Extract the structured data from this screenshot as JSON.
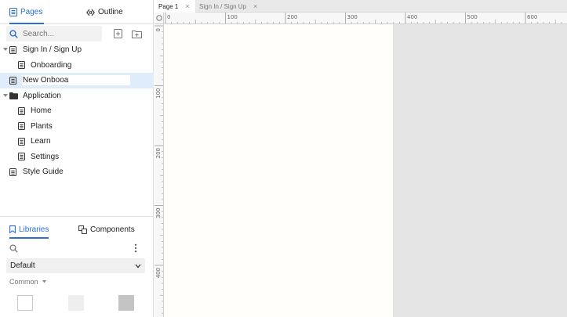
{
  "left_panel": {
    "tabs": [
      {
        "label": "Pages",
        "icon": "page-icon",
        "active": true
      },
      {
        "label": "Outline",
        "icon": "outline-icon",
        "active": false
      }
    ],
    "search": {
      "placeholder": "Search...",
      "value": ""
    },
    "tree": [
      {
        "label": "Sign In / Sign Up",
        "depth": 0,
        "type": "page",
        "expanded": true
      },
      {
        "label": "Onboarding",
        "depth": 1,
        "type": "page"
      },
      {
        "label": "",
        "depth": 0,
        "type": "page",
        "selected": true,
        "editing": true,
        "edit_value": "New Onbooa"
      },
      {
        "label": "Application",
        "depth": 0,
        "type": "folder",
        "expanded": true
      },
      {
        "label": "Home",
        "depth": 1,
        "type": "page"
      },
      {
        "label": "Plants",
        "depth": 1,
        "type": "page"
      },
      {
        "label": "Learn",
        "depth": 1,
        "type": "page"
      },
      {
        "label": "Settings",
        "depth": 1,
        "type": "page"
      },
      {
        "label": "Style Guide",
        "depth": 0,
        "type": "page"
      }
    ]
  },
  "libraries_panel": {
    "tabs": [
      {
        "label": "Libraries",
        "icon": "bookmark-icon",
        "active": true
      },
      {
        "label": "Components",
        "icon": "components-icon",
        "active": false
      }
    ],
    "library_select": {
      "value": "Default"
    },
    "category": {
      "label": "Common"
    },
    "swatches": [
      "#ffffff",
      "#eeeeee",
      "#c4c4c4"
    ]
  },
  "document_tabs": [
    {
      "label": "Page 1",
      "active": true
    },
    {
      "label": "Sign In / Sign Up",
      "active": false
    }
  ],
  "ruler": {
    "h_labels": [
      "0",
      "100",
      "200",
      "300",
      "400",
      "500",
      "600"
    ],
    "v_labels": [
      "0",
      "100",
      "200",
      "300",
      "400"
    ]
  },
  "colors": {
    "accent": "#2a6fd6",
    "selected_row": "#dfecfb",
    "canvas": "#fffefb",
    "pasteboard": "#e5e5e5"
  }
}
